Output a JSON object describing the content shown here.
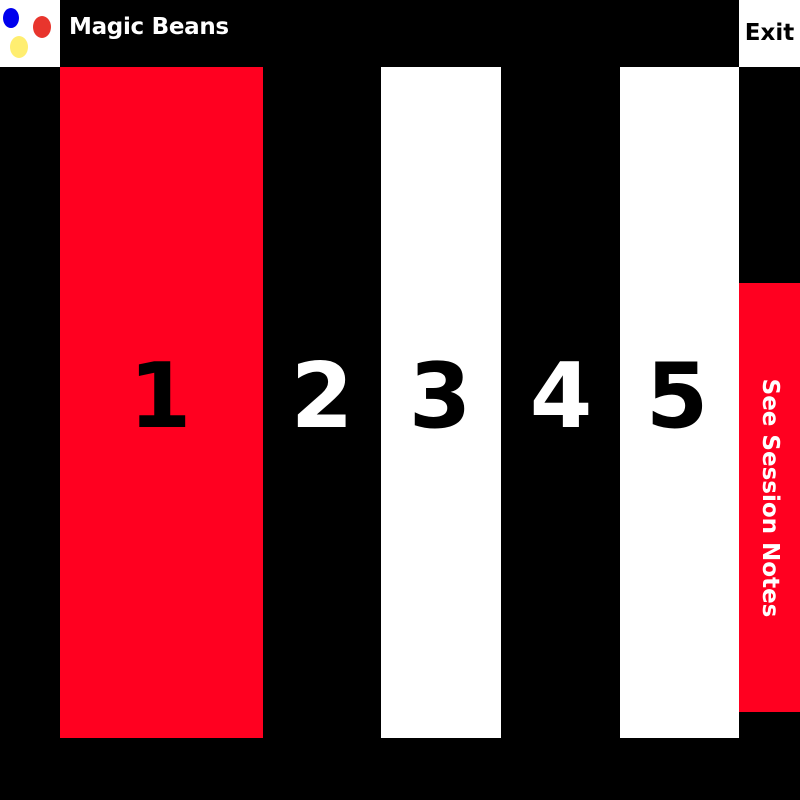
{
  "app": {
    "title": "Magic Beans",
    "logo_dots": [
      "#0000ee",
      "#e8352d",
      "#ffee70"
    ]
  },
  "header": {
    "exit_label": "Exit"
  },
  "options": [
    {
      "label": "1",
      "selected": true,
      "bar_color": "#ff0020",
      "text_color": "#000000"
    },
    {
      "label": "2",
      "selected": false,
      "bar_color": "#000000",
      "text_color": "#ffffff"
    },
    {
      "label": "3",
      "selected": false,
      "bar_color": "#ffffff",
      "text_color": "#000000"
    },
    {
      "label": "4",
      "selected": false,
      "bar_color": "#000000",
      "text_color": "#ffffff"
    },
    {
      "label": "5",
      "selected": false,
      "bar_color": "#ffffff",
      "text_color": "#000000"
    }
  ],
  "notes": {
    "label": "See Session Notes",
    "color": "#ff0020"
  },
  "colors": {
    "background": "#000000",
    "accent": "#ff0020",
    "light": "#ffffff"
  }
}
